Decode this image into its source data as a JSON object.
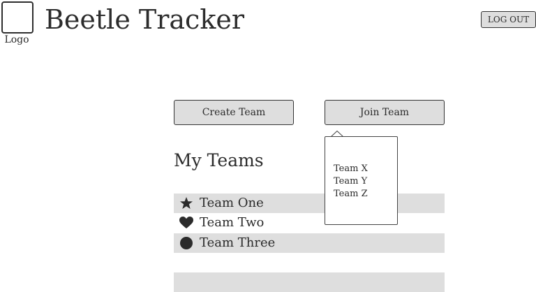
{
  "header": {
    "logo_label": "Logo",
    "app_title": "Beetle Tracker",
    "logout_label": "LOG OUT"
  },
  "actions": {
    "create_team_label": "Create Team",
    "join_team_label": "Join Team"
  },
  "join_popover": {
    "options": [
      "Team X",
      "Team Y",
      "Team Z"
    ]
  },
  "my_teams": {
    "heading": "My Teams",
    "teams": [
      {
        "label": "Team One",
        "icon": "star-icon"
      },
      {
        "label": "Team Two",
        "icon": "heart-icon"
      },
      {
        "label": "Team Three",
        "icon": "circle-icon"
      }
    ]
  },
  "colors": {
    "row_shade": "#dedede",
    "button_fill": "#dedede",
    "text": "#2a2a2a"
  }
}
